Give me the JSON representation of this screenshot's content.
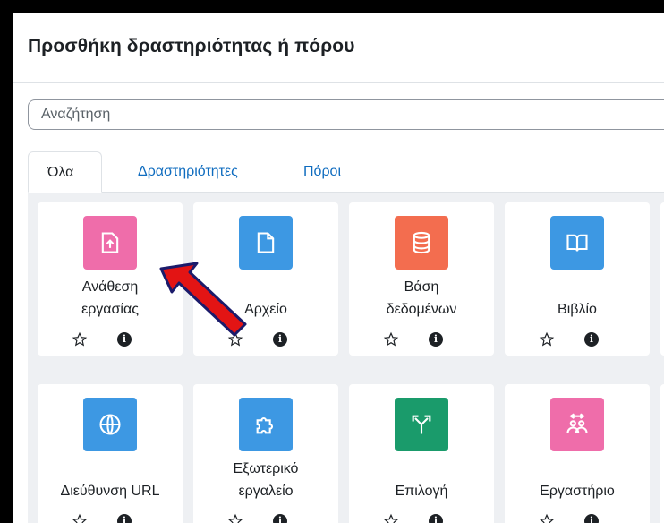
{
  "dialog": {
    "title": "Προσθήκη δραστηριότητας ή πόρου"
  },
  "search": {
    "placeholder": "Αναζήτηση"
  },
  "tabs": [
    {
      "label": "Όλα",
      "active": true
    },
    {
      "label": "Δραστηριότητες",
      "active": false
    },
    {
      "label": "Πόροι",
      "active": false
    }
  ],
  "modules": [
    {
      "line1": "Ανάθεση",
      "line2": "εργασίας",
      "icon": "assignment-upload-icon",
      "color": "#ef6daa"
    },
    {
      "line1": "",
      "line2": "Αρχείο",
      "icon": "file-icon",
      "color": "#3d98e3"
    },
    {
      "line1": "Βάση",
      "line2": "δεδομένων",
      "icon": "database-icon",
      "color": "#f36d4f"
    },
    {
      "line1": "",
      "line2": "Βιβλίο",
      "icon": "book-icon",
      "color": "#3d98e3"
    },
    {
      "line1": "",
      "line2": "Διεύθυνση URL",
      "icon": "globe-icon",
      "color": "#3d98e3"
    },
    {
      "line1": "Εξωτερικό",
      "line2": "εργαλείο",
      "icon": "puzzle-icon",
      "color": "#3d98e3"
    },
    {
      "line1": "",
      "line2": "Επιλογή",
      "icon": "choice-signpost-icon",
      "color": "#1a9b6b"
    },
    {
      "line1": "",
      "line2": "Εργαστήριο",
      "icon": "workshop-people-icon",
      "color": "#ef6daa"
    }
  ],
  "common": {
    "info_glyph": "i",
    "star_glyph": "☆"
  }
}
